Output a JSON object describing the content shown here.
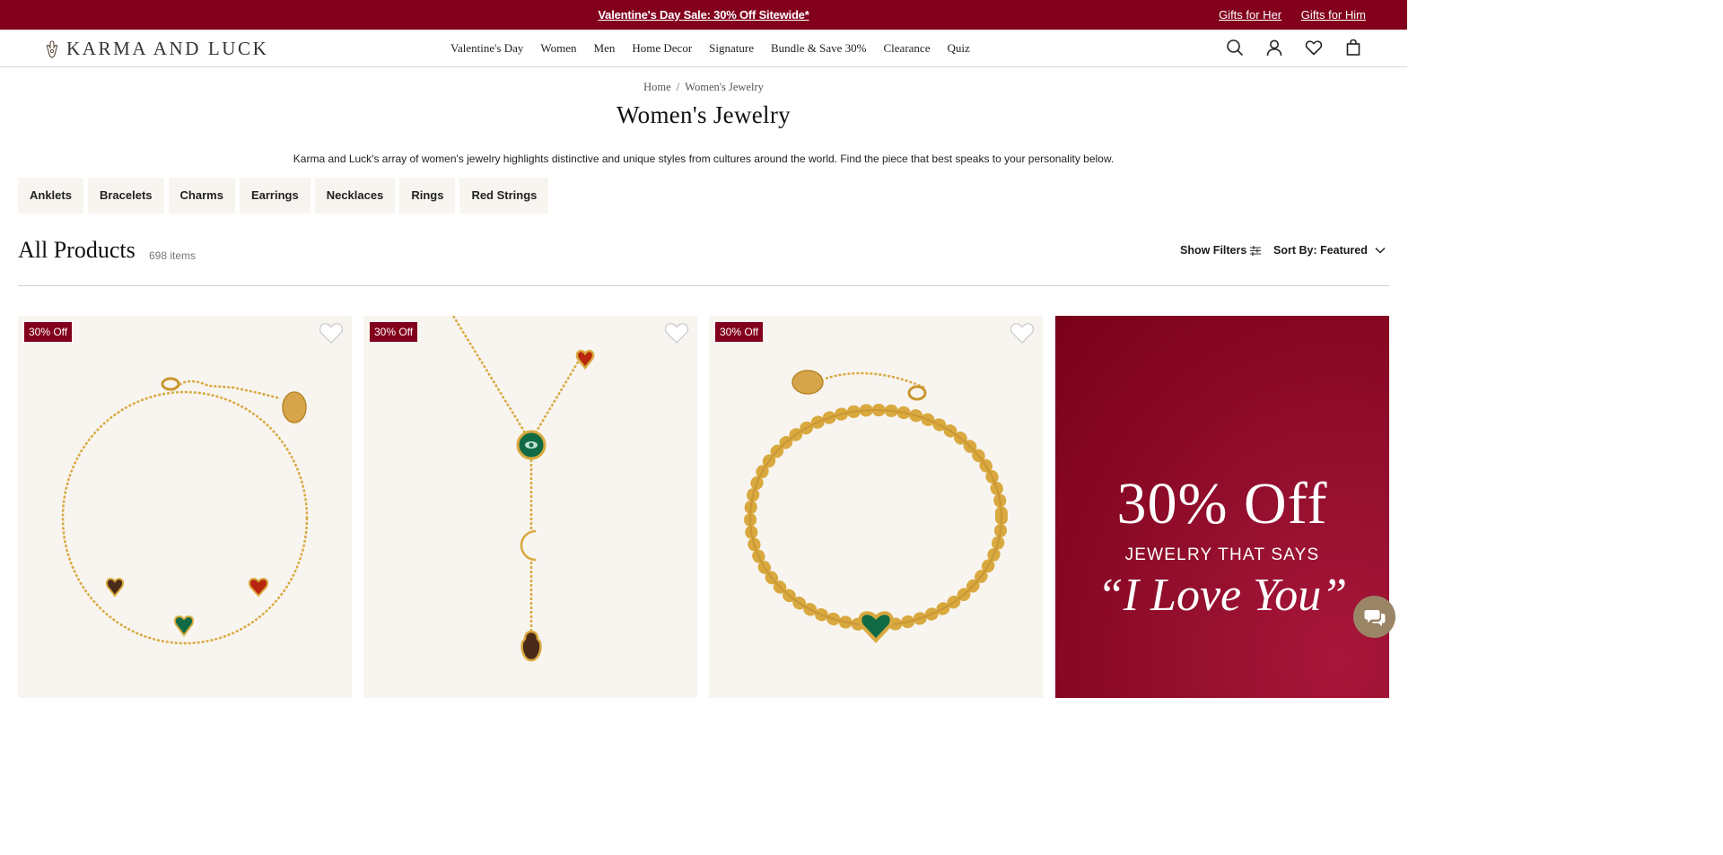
{
  "promo_bar": {
    "sale_text": "Valentine's Day Sale: 30% Off Sitewide*",
    "links": [
      "Gifts for Her",
      "Gifts for Him"
    ]
  },
  "nav": {
    "logo_text": "KARMA AND LUCK",
    "menu": [
      "Valentine's Day",
      "Women",
      "Men",
      "Home Decor",
      "Signature",
      "Bundle & Save 30%",
      "Clearance",
      "Quiz"
    ],
    "icons": [
      "search-icon",
      "account-icon",
      "wishlist-heart-icon",
      "bag-icon"
    ]
  },
  "breadcrumb": {
    "home": "Home",
    "separator": "/",
    "current": "Women's Jewelry"
  },
  "page": {
    "title": "Women's Jewelry",
    "description": "Karma and Luck's array of women's jewelry highlights distinctive and unique styles from cultures around the world. Find the piece that best speaks to your personality below."
  },
  "categories": [
    "Anklets",
    "Bracelets",
    "Charms",
    "Earrings",
    "Necklaces",
    "Rings",
    "Red Strings"
  ],
  "listing": {
    "heading": "All Products",
    "count": "698 items",
    "filters_label": "Show Filters",
    "sort_label": "Sort By: Featured"
  },
  "products": [
    {
      "badge": "30% Off",
      "image": "gold-chain-bracelet-three-hearts"
    },
    {
      "badge": "30% Off",
      "image": "gold-lariat-necklace-heart-eye-moon-hamsa"
    },
    {
      "badge": "30% Off",
      "image": "gold-beaded-bracelet-green-heart"
    }
  ],
  "promo_tile": {
    "headline": "30% Off",
    "subline": "JEWELRY THAT SAYS",
    "tagline": "“I Love You”"
  },
  "colors": {
    "brand_red": "#83001c",
    "card_bg": "#f8f5f0",
    "gold": "#d9a93f",
    "chat_bubble": "#9a8567"
  }
}
